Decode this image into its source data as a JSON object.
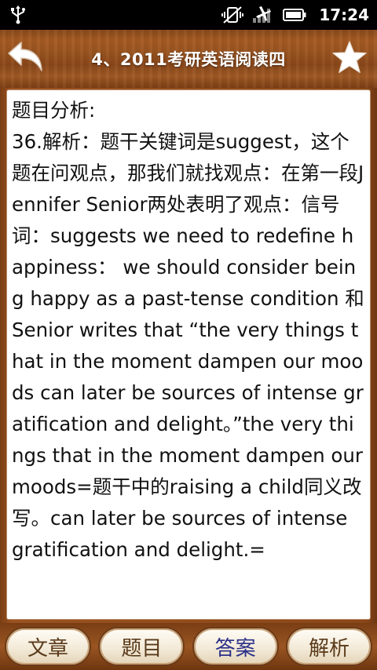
{
  "status_bar": {
    "time": "17:24",
    "icons": [
      "usb-icon",
      "vibrate-muted-icon",
      "signal-airplane-icon",
      "battery-icon"
    ]
  },
  "header": {
    "title": "4、2011考研英语阅读四",
    "back_icon": "back-arrow-icon",
    "favorite_icon": "star-icon"
  },
  "content": {
    "paragraphs": [
      "题目分析:",
      "36.解析：题干关键词是suggest，这个题在问观点，那我们就找观点：在第一段Jennifer Senior两处表明了观点：信号词：suggests we need to redefine happiness： we should consider being happy as a past-tense condition 和Senior writes that “the very things that in the moment dampen our moods can later be sources of intense gratification and delight。”the very things that in the moment dampen our moods=题干中的raising a child同义改写。can later be sources of intense gratification and delight.="
    ]
  },
  "tabs": [
    {
      "label": "文章",
      "active": false
    },
    {
      "label": "题目",
      "active": false
    },
    {
      "label": "答案",
      "active": true
    },
    {
      "label": "解析",
      "active": false
    }
  ],
  "colors": {
    "wood": "#9a5420",
    "active_tab_text": "#2a2f88",
    "tab_text": "#5a3a1a"
  }
}
